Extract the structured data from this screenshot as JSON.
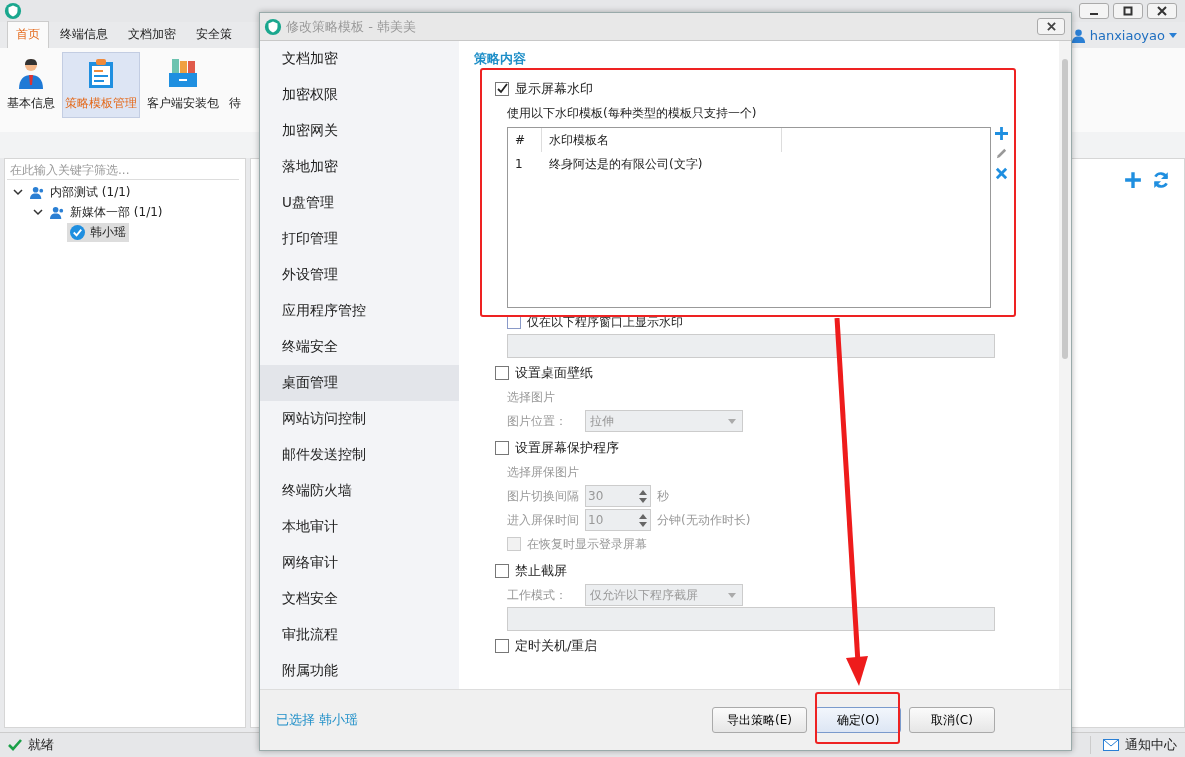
{
  "app": {
    "user": "hanxiaoyao",
    "tabs": [
      {
        "label": "首页",
        "selected": true
      },
      {
        "label": "终端信息",
        "selected": false
      },
      {
        "label": "文档加密",
        "selected": false
      },
      {
        "label": "安全策",
        "selected": false
      }
    ],
    "ribbon": [
      {
        "label": "基本信息",
        "selected": false
      },
      {
        "label": "策略模板管理",
        "selected": true
      },
      {
        "label": "客户端安装包",
        "selected": false
      },
      {
        "label": "待",
        "selected": false
      }
    ],
    "search": {
      "placeholder": "在此输入关键字筛选..."
    },
    "tree": [
      {
        "label": "内部测试 (1/1)",
        "kind": "group",
        "expanded": true,
        "selected": false,
        "children": [
          {
            "label": "新媒体一部 (1/1)",
            "kind": "group",
            "expanded": true,
            "selected": false,
            "children": [
              {
                "label": "韩小瑶",
                "kind": "user",
                "selected": true
              }
            ]
          }
        ]
      }
    ],
    "status": "就绪",
    "notify": "通知中心"
  },
  "dialog": {
    "title": "修改策略模板 - 韩美美",
    "nav": [
      {
        "label": "文档加密",
        "selected": false
      },
      {
        "label": "加密权限",
        "selected": false
      },
      {
        "label": "加密网关",
        "selected": false
      },
      {
        "label": "落地加密",
        "selected": false
      },
      {
        "label": "U盘管理",
        "selected": false
      },
      {
        "label": "打印管理",
        "selected": false
      },
      {
        "label": "外设管理",
        "selected": false
      },
      {
        "label": "应用程序管控",
        "selected": false
      },
      {
        "label": "终端安全",
        "selected": false
      },
      {
        "label": "桌面管理",
        "selected": true
      },
      {
        "label": "网站访问控制",
        "selected": false
      },
      {
        "label": "邮件发送控制",
        "selected": false
      },
      {
        "label": "终端防火墙",
        "selected": false
      },
      {
        "label": "本地审计",
        "selected": false
      },
      {
        "label": "网络审计",
        "selected": false
      },
      {
        "label": "文档安全",
        "selected": false
      },
      {
        "label": "审批流程",
        "selected": false
      },
      {
        "label": "附属功能",
        "selected": false
      }
    ],
    "section": "策略内容",
    "settings": [
      {
        "kind": "check",
        "label": "显示屏幕水印",
        "checked": true
      },
      {
        "kind": "note",
        "text": "使用以下水印模板(每种类型的模板只支持一个)"
      },
      {
        "kind": "table",
        "columns": [
          "#",
          "水印模板名"
        ],
        "rows": [
          [
            "1",
            "终身阿达是的有限公司(文字)"
          ]
        ]
      },
      {
        "kind": "subcheck",
        "label": "仅在以下程序窗口上显示水印",
        "checked": false,
        "disabled": false
      },
      {
        "kind": "box"
      },
      {
        "kind": "check",
        "label": "设置桌面壁纸",
        "checked": false
      },
      {
        "kind": "label",
        "text": "选择图片"
      },
      {
        "kind": "select",
        "label": "图片位置：",
        "value": "拉伸"
      },
      {
        "kind": "check",
        "label": "设置屏幕保护程序",
        "checked": false
      },
      {
        "kind": "label",
        "text": "选择屏保图片"
      },
      {
        "kind": "spin",
        "label": "图片切换间隔",
        "value": "30",
        "unit": "秒"
      },
      {
        "kind": "spin",
        "label": "进入屏保时间",
        "value": "10",
        "unit": "分钟(无动作时长)"
      },
      {
        "kind": "subcheck",
        "label": "在恢复时显示登录屏幕",
        "checked": false,
        "disabled": true
      },
      {
        "kind": "check",
        "label": "禁止截屏",
        "checked": false
      },
      {
        "kind": "select",
        "label": "工作模式：",
        "value": "仅允许以下程序截屏"
      },
      {
        "kind": "box"
      },
      {
        "kind": "check",
        "label": "定时关机/重启",
        "checked": false
      }
    ],
    "footer_label": "已选择",
    "footer_user": "韩小瑶",
    "buttons": [
      {
        "label": "导出策略(E)",
        "primary": false
      },
      {
        "label": "确定(O)",
        "primary": true
      },
      {
        "label": "取消(C)",
        "primary": false
      }
    ]
  }
}
